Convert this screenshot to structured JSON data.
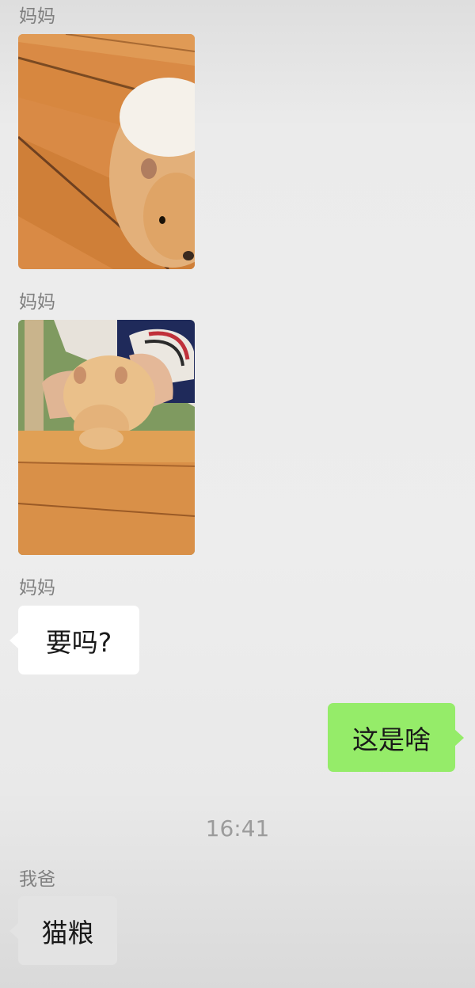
{
  "messages": [
    {
      "sender": "妈妈",
      "type": "image",
      "subject": "hamster-on-wooden-table"
    },
    {
      "sender": "妈妈",
      "type": "image",
      "subject": "hamster-held-in-hand"
    },
    {
      "sender": "妈妈",
      "type": "text",
      "text": "要吗?"
    },
    {
      "sender": "self",
      "type": "text",
      "text": "这是啥"
    },
    {
      "sender": "我爸",
      "type": "text",
      "text": "猫粮"
    }
  ],
  "timestamp": "16:41",
  "colors": {
    "outgoing_bubble": "#95ec69",
    "incoming_bubble": "#ffffff",
    "sender_name": "#808080",
    "timestamp": "#9b9b9b"
  }
}
